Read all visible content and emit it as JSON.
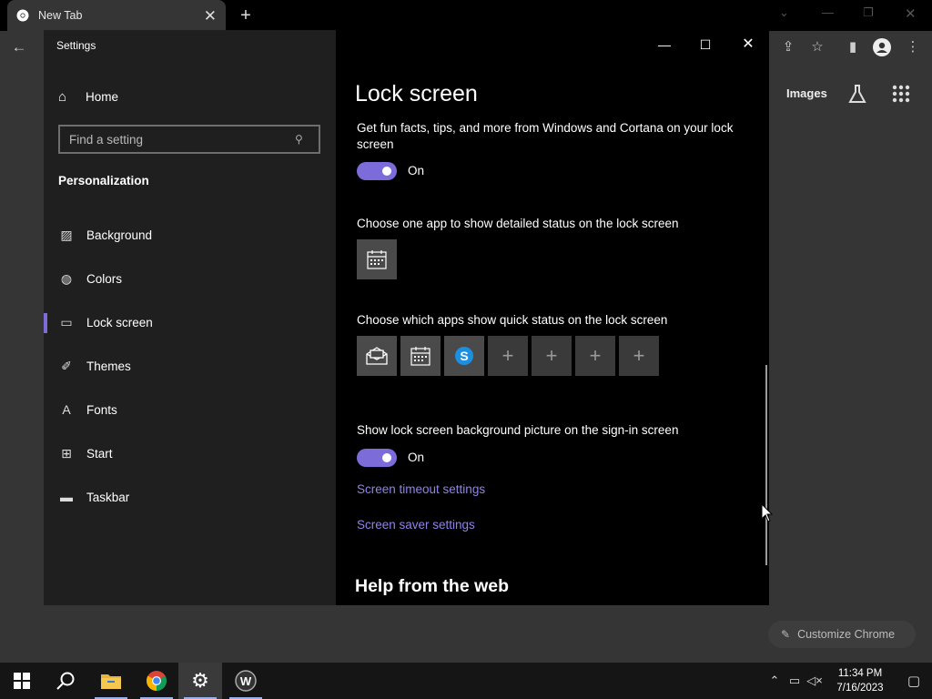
{
  "chrome": {
    "tab_title": "New Tab",
    "tab_close": "✕",
    "new_tab": "+",
    "images_link": "Images",
    "customize_button": "Customize Chrome"
  },
  "settings": {
    "window_title": "Settings",
    "nav": {
      "home": "Home",
      "search_placeholder": "Find a setting",
      "section": "Personalization",
      "items": [
        {
          "label": "Background",
          "icon": "picture-icon",
          "selected": false
        },
        {
          "label": "Colors",
          "icon": "palette-icon",
          "selected": false
        },
        {
          "label": "Lock screen",
          "icon": "lock-screen-icon",
          "selected": true
        },
        {
          "label": "Themes",
          "icon": "themes-icon",
          "selected": false
        },
        {
          "label": "Fonts",
          "icon": "fonts-icon",
          "selected": false
        },
        {
          "label": "Start",
          "icon": "start-icon",
          "selected": false
        },
        {
          "label": "Taskbar",
          "icon": "taskbar-icon",
          "selected": false
        }
      ]
    },
    "content": {
      "title": "Lock screen",
      "fun_facts_text": "Get fun facts, tips, and more from Windows and Cortana on your lock screen",
      "fun_facts_toggle": "On",
      "detailed_status_label": "Choose one app to show detailed status on the lock screen",
      "quick_status_label": "Choose which apps show quick status on the lock screen",
      "quick_status_apps": [
        "mail-icon",
        "calendar-icon",
        "skype-icon",
        "add-icon",
        "add-icon",
        "add-icon",
        "add-icon"
      ],
      "signin_bg_label": "Show lock screen background picture on the sign-in screen",
      "signin_bg_toggle": "On",
      "timeout_link": "Screen timeout settings",
      "screensaver_link": "Screen saver settings",
      "help_title": "Help from the web"
    }
  },
  "taskbar": {
    "time": "11:34 PM",
    "date": "7/16/2023",
    "apps": [
      "start-icon",
      "search-icon",
      "file-explorer-icon",
      "chrome-icon",
      "settings-icon",
      "app-w-icon"
    ]
  },
  "colors": {
    "accent": "#7b6cd9",
    "link": "#8f84e8"
  }
}
